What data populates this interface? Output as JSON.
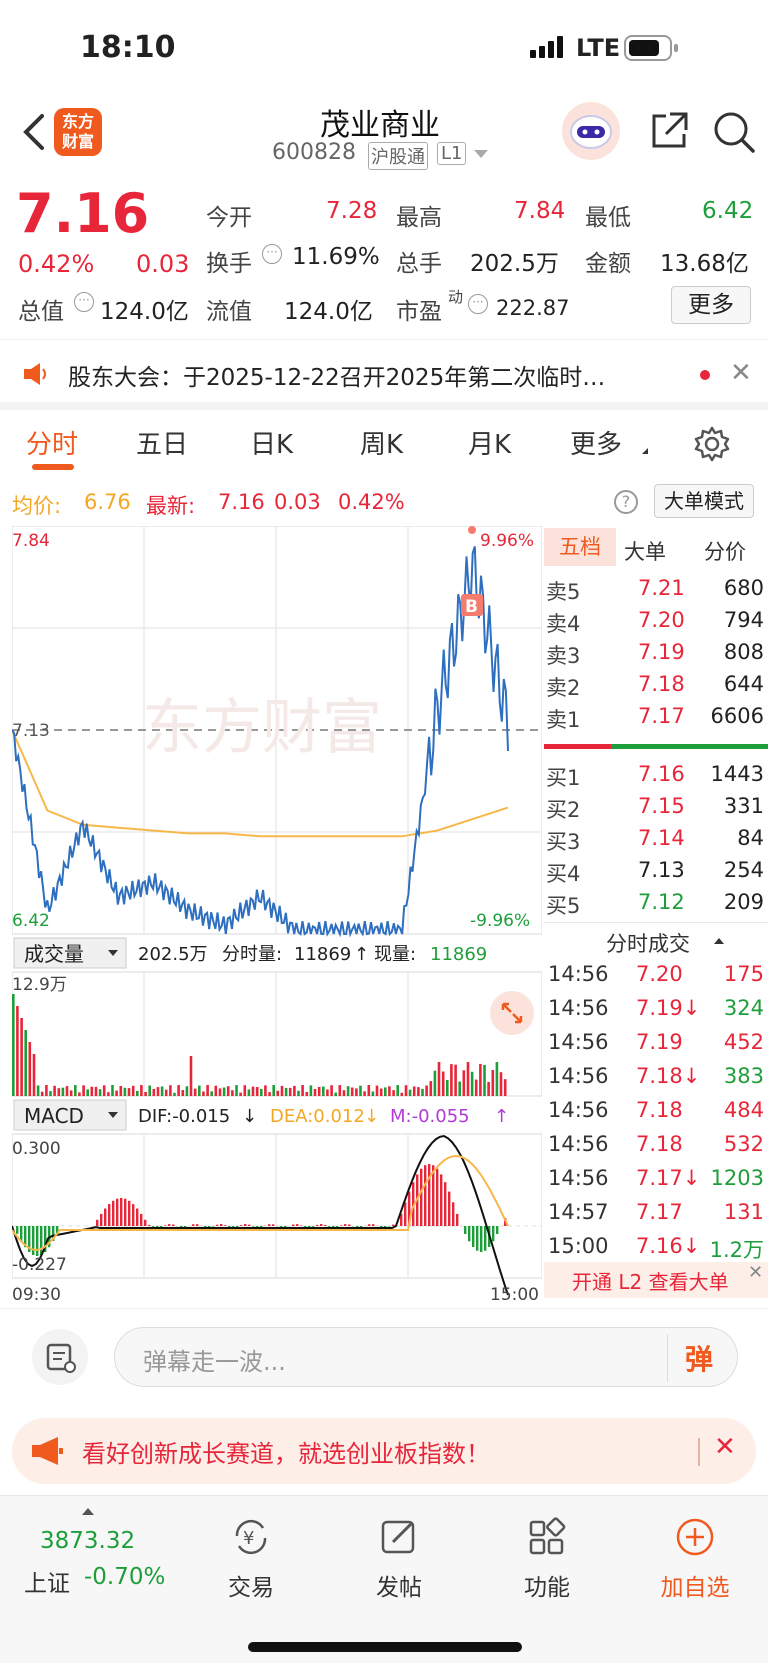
{
  "status": {
    "time": "18:10",
    "network": "LTE"
  },
  "header": {
    "name": "茂业商业",
    "code": "600828",
    "tag1": "沪股通",
    "tag2": "L1",
    "logo_line1": "东方",
    "logo_line2": "财富"
  },
  "quote": {
    "price": "7.16",
    "change_pct": "0.42%",
    "change": "0.03",
    "open_label": "今开",
    "open": "7.28",
    "high_label": "最高",
    "high": "7.84",
    "low_label": "最低",
    "low": "6.42",
    "turnover_label": "换手",
    "turnover": "11.69%",
    "volume_label": "总手",
    "volume": "202.5万",
    "amount_label": "金额",
    "amount": "13.68亿",
    "mcap_label": "总值",
    "mcap": "124.0亿",
    "float_label": "流值",
    "float": "124.0亿",
    "pe_label": "市盈",
    "pe_sup": "动",
    "pe": "222.87",
    "more": "更多"
  },
  "notice": {
    "text": "股东大会：于2025-12-22召开2025年第二次临时…"
  },
  "tabs": [
    "分时",
    "五日",
    "日K",
    "周K",
    "月K",
    "更多"
  ],
  "infobar": {
    "avg_label": "均价:",
    "avg": "6.76",
    "latest_label": "最新:",
    "latest": "7.16",
    "chg": "0.03",
    "pct": "0.42%",
    "mode": "大单模式"
  },
  "chart": {
    "top_left": "7.84",
    "top_right": "9.96%",
    "mid": "7.13",
    "bottom_left": "6.42",
    "bottom_right": "-9.96%",
    "watermark": "东方财富",
    "vol_selector": "成交量",
    "vol_total": "202.5万",
    "vol_min_label": "分时量:",
    "vol_min": "11869",
    "vol_now_label": "现量:",
    "vol_now": "11869",
    "vol_max": "12.9万",
    "macd_selector": "MACD",
    "dif": "DIF:-0.015",
    "dea": "DEA:0.012",
    "m": "M:-0.055",
    "macd_top": "0.300",
    "macd_bottom": "-0.227",
    "time_start": "09:30",
    "time_end": "15:00",
    "marker": "B"
  },
  "chart_data": {
    "type": "line",
    "title": "",
    "series": [
      {
        "name": "均价",
        "values": [
          7.13,
          6.85,
          6.8,
          6.79,
          6.78,
          6.77,
          6.77,
          6.76,
          6.76,
          6.76,
          6.76,
          6.76,
          6.78,
          6.82,
          6.86
        ]
      },
      {
        "name": "最新",
        "values": [
          7.13,
          6.5,
          6.8,
          6.55,
          6.6,
          6.5,
          6.45,
          6.55,
          6.43,
          6.43,
          6.43,
          6.43,
          7.2,
          7.7,
          7.16
        ]
      }
    ],
    "x": [
      "09:30",
      "",
      "",
      "",
      "",
      "",
      "",
      "",
      "",
      "",
      "",
      "",
      "",
      "",
      "15:00"
    ],
    "ylim": [
      6.42,
      7.84
    ]
  },
  "orderbook": {
    "tabs": [
      "五档",
      "大单",
      "分价"
    ],
    "asks": [
      {
        "label": "卖5",
        "price": "7.21",
        "vol": "680"
      },
      {
        "label": "卖4",
        "price": "7.20",
        "vol": "794"
      },
      {
        "label": "卖3",
        "price": "7.19",
        "vol": "808"
      },
      {
        "label": "卖2",
        "price": "7.18",
        "vol": "644"
      },
      {
        "label": "卖1",
        "price": "7.17",
        "vol": "6606"
      }
    ],
    "bids": [
      {
        "label": "买1",
        "price": "7.16",
        "vol": "1443"
      },
      {
        "label": "买2",
        "price": "7.15",
        "vol": "331"
      },
      {
        "label": "买3",
        "price": "7.14",
        "vol": "84"
      },
      {
        "label": "买4",
        "price": "7.13",
        "vol": "254"
      },
      {
        "label": "买5",
        "price": "7.12",
        "vol": "209"
      }
    ],
    "trades_title": "分时成交",
    "trades": [
      {
        "time": "14:56",
        "price": "7.20",
        "vol": "175",
        "dir": "up"
      },
      {
        "time": "14:56",
        "price": "7.19↓",
        "vol": "324",
        "dir": "down"
      },
      {
        "time": "14:56",
        "price": "7.19",
        "vol": "452",
        "dir": "up"
      },
      {
        "time": "14:56",
        "price": "7.18↓",
        "vol": "383",
        "dir": "down"
      },
      {
        "time": "14:56",
        "price": "7.18",
        "vol": "484",
        "dir": "up"
      },
      {
        "time": "14:56",
        "price": "7.18",
        "vol": "532",
        "dir": "up"
      },
      {
        "time": "14:56",
        "price": "7.17↓",
        "vol": "1203",
        "dir": "down"
      },
      {
        "time": "14:57",
        "price": "7.17",
        "vol": "131",
        "dir": "up"
      },
      {
        "time": "15:00",
        "price": "7.16↓",
        "vol": "1.2万",
        "dir": "down"
      }
    ],
    "l2": "开通 L2 查看大单"
  },
  "comment": {
    "placeholder": "弹幕走一波...",
    "danmu": "弹"
  },
  "promo": {
    "text": "看好创新成长赛道，就选创业板指数！"
  },
  "bottomnav": {
    "index_value": "3873.32",
    "index_name": "上证",
    "index_pct": "-0.70%",
    "items": [
      "交易",
      "发帖",
      "功能",
      "加自选"
    ]
  }
}
